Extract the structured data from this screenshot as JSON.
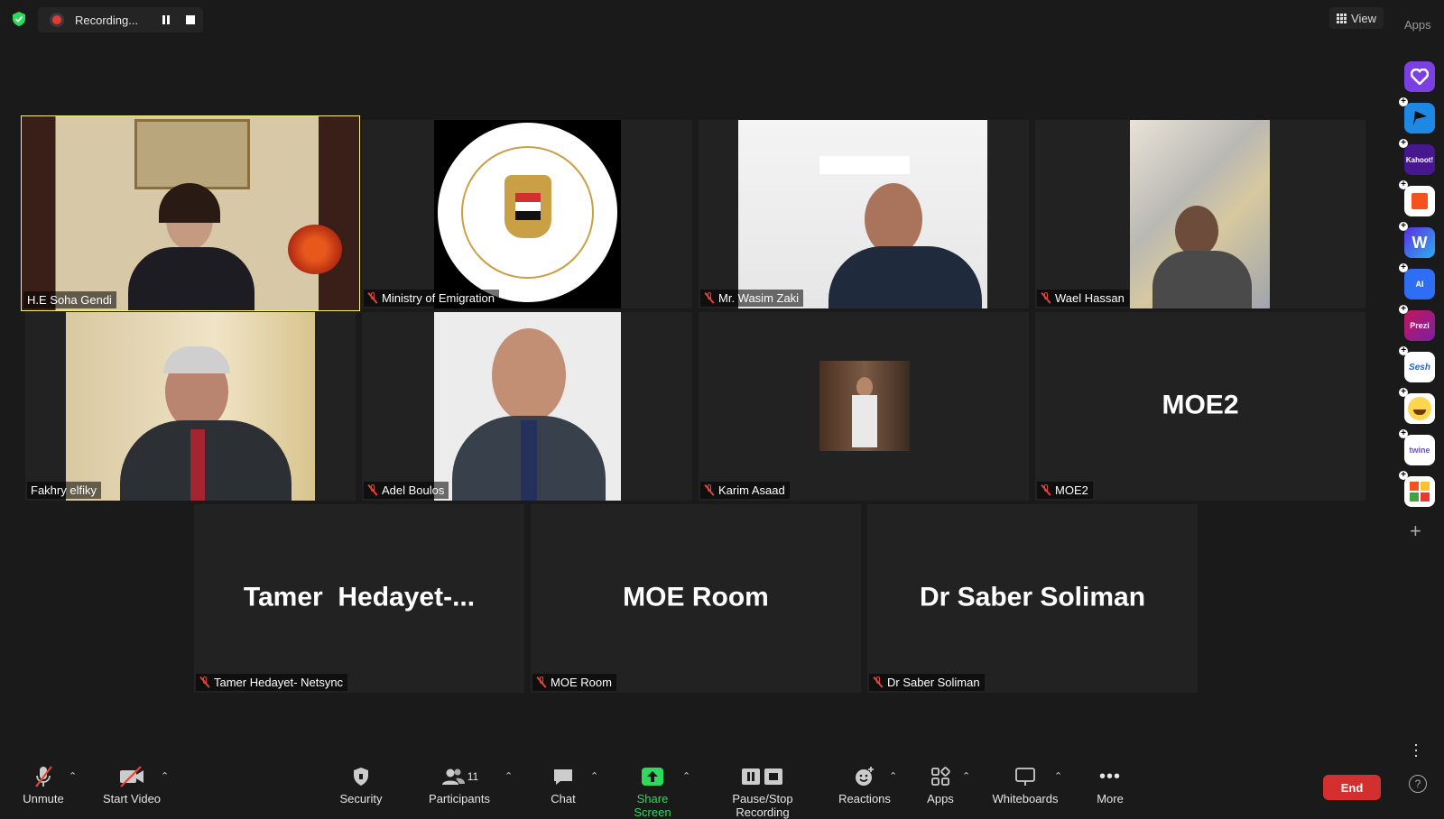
{
  "top": {
    "recording_label": "Recording...",
    "view_label": "View",
    "apps_label": "Apps"
  },
  "participants": [
    {
      "name": "H.E Soha Gendi",
      "muted": false,
      "active": true
    },
    {
      "name": "Ministry of Emigration",
      "muted": true
    },
    {
      "name": "Mr. Wasim Zaki",
      "muted": true
    },
    {
      "name": "Wael Hassan",
      "muted": true
    },
    {
      "name": "Fakhry elfiky",
      "muted": false
    },
    {
      "name": "Adel Boulos",
      "muted": true
    },
    {
      "name": "Karim Asaad",
      "muted": true
    },
    {
      "name": "MOE2",
      "muted": true,
      "display": "MOE2"
    },
    {
      "name": "Tamer Hedayet- Netsync",
      "muted": true,
      "display": "Tamer  Hedayet-..."
    },
    {
      "name": "MOE Room",
      "muted": true,
      "display": "MOE Room"
    },
    {
      "name": "Dr Saber Soliman",
      "muted": true,
      "display": "Dr Saber Soliman"
    }
  ],
  "sidebar_apps": [
    {
      "name": "heart-app",
      "label": "",
      "color": "#7b3fe4"
    },
    {
      "name": "flag-app",
      "label": "",
      "color": "#1e88e5"
    },
    {
      "name": "kahoot-app",
      "label": "Kahoot!",
      "color": "#46178f"
    },
    {
      "name": "red-app",
      "label": "",
      "color": "#ffffff"
    },
    {
      "name": "w-app",
      "label": "W",
      "color": "#5b2ee6"
    },
    {
      "name": "ai-app",
      "label": "AI",
      "color": "#2d6ef5"
    },
    {
      "name": "prezi-app",
      "label": "Prezi",
      "color": "#c2185b"
    },
    {
      "name": "sesh-app",
      "label": "Sesh",
      "color": "#ffffff"
    },
    {
      "name": "emoji-app",
      "label": "",
      "color": "#ffd54f"
    },
    {
      "name": "twine-app",
      "label": "twine",
      "color": "#ffffff"
    },
    {
      "name": "blocks-app",
      "label": "",
      "color": "#ffffff"
    }
  ],
  "toolbar": {
    "unmute": "Unmute",
    "start_video": "Start Video",
    "security": "Security",
    "participants": "Participants",
    "participant_count": "11",
    "chat": "Chat",
    "share_screen": "Share Screen",
    "pause_recording": "Pause/Stop Recording",
    "reactions": "Reactions",
    "apps": "Apps",
    "whiteboards": "Whiteboards",
    "more": "More",
    "end": "End"
  },
  "colors": {
    "background": "#1a1a1a",
    "tile": "#222222",
    "active_speaker": "#f5f07a",
    "end_button": "#d32f2f",
    "share_green": "#2fd95c",
    "mute_red": "#e0453a"
  }
}
